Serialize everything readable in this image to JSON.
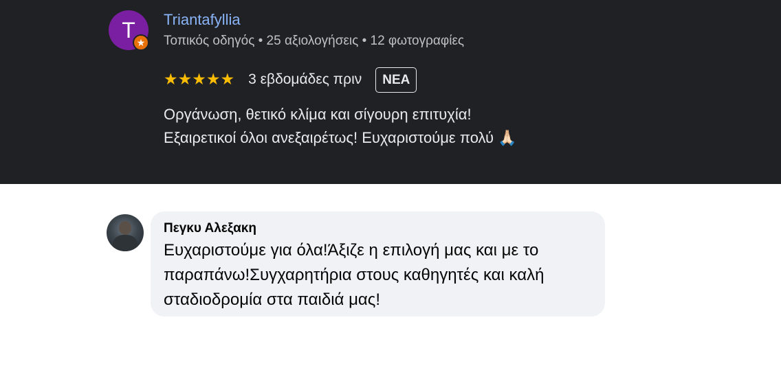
{
  "review": {
    "avatar_letter": "T",
    "avatar_color": "#7b1fa2",
    "local_guide_icon": "star-badge-icon",
    "local_guide_glyph": "★",
    "reviewer_name": "Triantafyllia",
    "reviewer_meta": "Τοπικός οδηγός • 25 αξιολογήσεις • 12 φωτογραφίες",
    "rating": 5,
    "stars": "★★★★★",
    "time_ago": "3 εβδομάδες πριν",
    "new_badge": "ΝΕΑ",
    "text_lines": [
      "Οργάνωση, θετικό κλίμα και σίγουρη επιτυχία!",
      "Εξαιρετικοί όλοι ανεξαιρέτως! Ευχαριστούμε πολύ 🙏🏻"
    ],
    "accent_name_color": "#8ab4f8",
    "star_color": "#fbbc04",
    "background_color": "#202124"
  },
  "comment": {
    "author": "Πεγκυ Αλεξακη",
    "text_lines": [
      "Ευχαριστούμε για όλα!Άξιζε η επιλογή μας και με το",
      "παραπάνω!Συγχαρητήρια στους καθηγητές και καλή",
      "σταδιοδρομία στα παιδιά μας!"
    ],
    "bubble_color": "#f0f2f5"
  }
}
